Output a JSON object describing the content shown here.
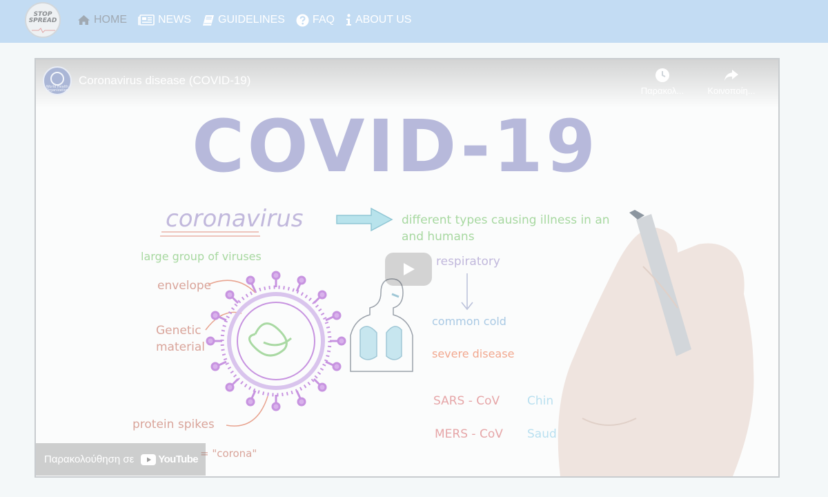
{
  "navbar": {
    "logo_text_line1": "STOP",
    "logo_text_line2": "SPREAD",
    "items": [
      {
        "label": "HOME",
        "icon": "home-icon",
        "active": true
      },
      {
        "label": "NEWS",
        "icon": "newspaper-icon",
        "active": false
      },
      {
        "label": "GUIDELINES",
        "icon": "book-icon",
        "active": false
      },
      {
        "label": "FAQ",
        "icon": "question-circle-icon",
        "active": false
      },
      {
        "label": "ABOUT US",
        "icon": "info-icon",
        "active": false
      }
    ]
  },
  "video": {
    "title": "Coronavirus disease (COVID-19)",
    "channel_label": "World Health Organization",
    "watch_later_label": "Παρακολ...",
    "share_label": "Κοινοποίη...",
    "watch_on_label": "Παρακολούθηση σε",
    "youtube_word": "YouTube"
  },
  "illustration": {
    "heading": "COVID-19",
    "coronavirus": "coronavirus",
    "different_types_line1": "different types causing illness in an",
    "different_types_line2": "and humans",
    "large_group": "large group of viruses",
    "envelope": "envelope",
    "genetic_line1": "Genetic",
    "genetic_line2": "material",
    "protein_spikes": "protein spikes",
    "corona": "= \"corona\"",
    "respiratory": "respiratory",
    "common_cold": "common cold",
    "severe_disease": "severe disease",
    "sars": "SARS - CoV",
    "sars_region": "Chin",
    "mers": "MERS - CoV",
    "mers_region": "Saud"
  },
  "colors": {
    "navbar_bg": "#c3dcf3",
    "nav_active": "#a0a9b2",
    "nav_text": "#ffffff",
    "heading_color": "#b7b9db",
    "green_text": "#a7d8a0",
    "salmon_text": "#e8a38f",
    "virus_purple": "#c793e0"
  }
}
